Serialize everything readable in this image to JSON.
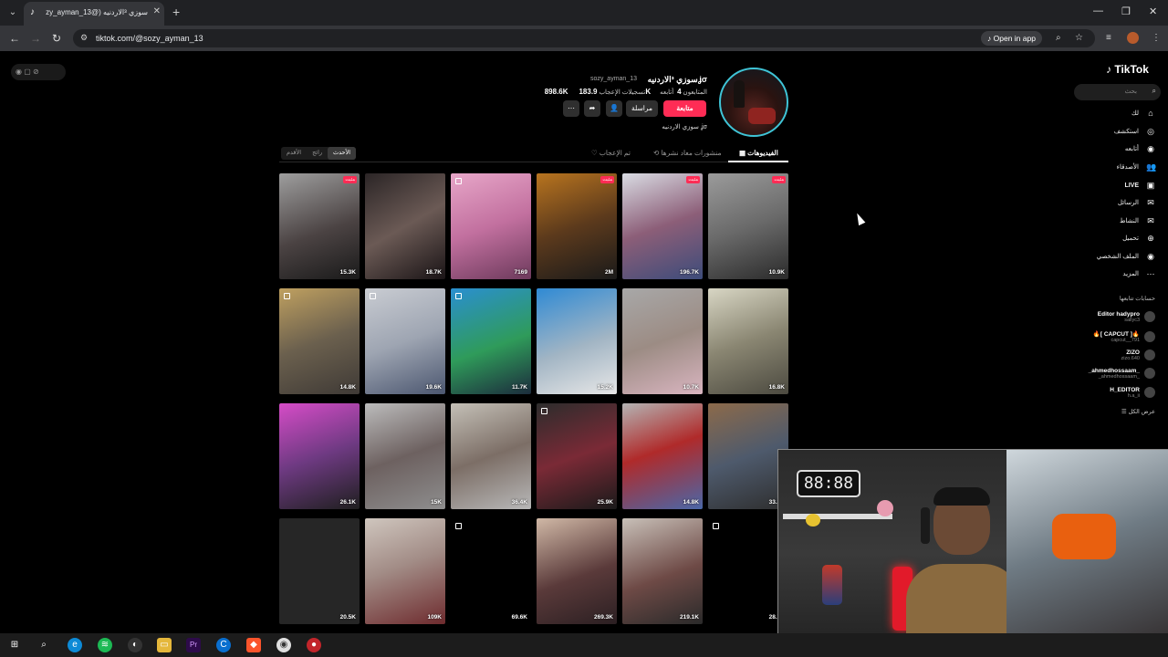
{
  "browser": {
    "tab_title": "سوزي ³الاردنيه (@sozy_ayman_13) | TikTok",
    "url": "tiktok.com/@sozy_ayman_13",
    "open_in_app": "Open in app"
  },
  "profile": {
    "display_name": "سوزي ³الاردنيهʝσ",
    "username": "sozy_ayman_13",
    "following_count": "4",
    "following_label": "أتابعه",
    "followers_count": "183.9K",
    "followers_label": "المتابعون",
    "likes_count": "898.6K",
    "likes_label": "تسجيلات الإعجاب",
    "follow_button": "متابعة",
    "message_button": "مراسلة",
    "bio": "سوزي الاردنيه ʝσ"
  },
  "profile_tabs": {
    "videos": "الفيديوهات",
    "reposts": "منشورات معاد نشرها",
    "liked": "تم الإعجاب"
  },
  "sort": [
    "الأحدث",
    "رائج",
    "الأقدم"
  ],
  "videos": [
    {
      "views": "15.3K",
      "pinned": true,
      "bg": "linear-gradient(160deg,#9e9e9e 0%,#4b4343 55%,#1a1a1a 100%)"
    },
    {
      "views": "18.7K",
      "pinned": false,
      "bg": "linear-gradient(150deg,#2b2526 0%,#6b5a55 50%,#1a1416 100%)"
    },
    {
      "views": "7169",
      "pinned": false,
      "bg": "linear-gradient(160deg,#e7a6c8 0%,#c2709f 50%,#6d3a5c 100%)"
    },
    {
      "views": "2M",
      "pinned": true,
      "bg": "linear-gradient(160deg,#b8741f 0%,#5c3a1c 50%,#1a1a1a 100%)"
    },
    {
      "views": "196.7K",
      "pinned": true,
      "bg": "linear-gradient(160deg,#d9dce3 0%,#8c5e78 50%,#3d4c7a 100%)"
    },
    {
      "views": "10.9K",
      "pinned": true,
      "bg": "linear-gradient(160deg,#9b9b9b 0%,#6a6a6a 50%,#2b2b2b 100%)"
    },
    {
      "views": "14.8K",
      "pinned": false,
      "bg": "linear-gradient(160deg,#bfa060 0%,#6b604e 50%,#3f3a36 100%)"
    },
    {
      "views": "19.6K",
      "pinned": false,
      "bg": "linear-gradient(160deg,#c9ccd2 0%,#9ea5b2 50%,#4c5770 100%)"
    },
    {
      "views": "11.7K",
      "pinned": false,
      "bg": "linear-gradient(160deg,#2a8fd0 0%,#2f9b5a 55%,#1c2c3d 100%)"
    },
    {
      "views": "15.2K",
      "pinned": false,
      "bg": "linear-gradient(160deg,#2f8ad4 0%,#a2b5c4 55%,#e7e7e7 100%)"
    },
    {
      "views": "10.7K",
      "pinned": false,
      "bg": "linear-gradient(160deg,#a8a8a8 0%,#9c8c84 50%,#d9b5c0 100%)"
    },
    {
      "views": "16.8K",
      "pinned": false,
      "bg": "linear-gradient(160deg,#d8d6c4 0%,#8a8672 50%,#4c4a40 100%)"
    },
    {
      "views": "26.1K",
      "pinned": false,
      "bg": "linear-gradient(160deg,#d64cc7 0%,#6e3a82 50%,#1f1f1f 100%)"
    },
    {
      "views": "15K",
      "pinned": false,
      "bg": "linear-gradient(160deg,#bcbcbc 0%,#6d6160 50%,#8e8e8e 100%)"
    },
    {
      "views": "36.4K",
      "pinned": false,
      "bg": "linear-gradient(160deg,#c4c0b7 0%,#7c6e66 50%,#b8b8b8 100%)"
    },
    {
      "views": "25.9K",
      "pinned": false,
      "bg": "linear-gradient(160deg,#2c2c2c 0%,#7a2a36 50%,#1a1a1a 100%)"
    },
    {
      "views": "14.8K",
      "pinned": false,
      "bg": "linear-gradient(160deg,#b4b4b4 0%,#b02a2a 45%,#4a67a8 100%)"
    },
    {
      "views": "33.3K",
      "pinned": false,
      "bg": "linear-gradient(160deg,#8c6a4a 0%,#4e5a6c 50%,#2e2e2e 100%)"
    },
    {
      "views": "20.5K",
      "pinned": false,
      "bg": "linear-gradient(160deg,#262626 0%,#262626 100%)"
    },
    {
      "views": "109K",
      "pinned": false,
      "bg": "linear-gradient(160deg,#cfc6be 0%,#a28c86 45%,#6e2b2e 100%)"
    },
    {
      "views": "69.6K",
      "pinned": false,
      "bg": "linear-gradient(160deg,#000 0%,#000 100%)"
    },
    {
      "views": "269.3K",
      "pinned": false,
      "bg": "linear-gradient(160deg,#d0b8a6 0%,#5a3a3a 55%,#2b1f22 100%)"
    },
    {
      "views": "219.1K",
      "pinned": false,
      "bg": "linear-gradient(160deg,#c8c0b8 0%,#6e4a46 55%,#2a2a2a 100%)"
    },
    {
      "views": "28.7K",
      "pinned": false,
      "bg": "linear-gradient(160deg,#000 0%,#000 100%)"
    }
  ],
  "tiktok_nav": {
    "logo": "TikTok",
    "search_placeholder": "بحث",
    "items": [
      "لك",
      "استكشف",
      "أتابعه",
      "الأصدقاء",
      "LIVE",
      "الرسائل",
      "النشاط",
      "تحميل",
      "الملف الشخصي",
      "المزيد"
    ]
  },
  "following_accounts": {
    "title": "حسابات تتابعها",
    "see_all": "عرض الكل",
    "accounts": [
      {
        "name": "Editor hadypro",
        "handle": "sallyc3"
      },
      {
        "name": "🔥[ CAPCUT ]🔥",
        "handle": "capcut__791"
      },
      {
        "name": "ZIZO",
        "handle": "zizo.640"
      },
      {
        "name": "_ahmedhossaam_",
        "handle": "_ahmedhossaam_"
      },
      {
        "name": "H_EDITOR",
        "handle": "h.a_ii"
      }
    ]
  }
}
